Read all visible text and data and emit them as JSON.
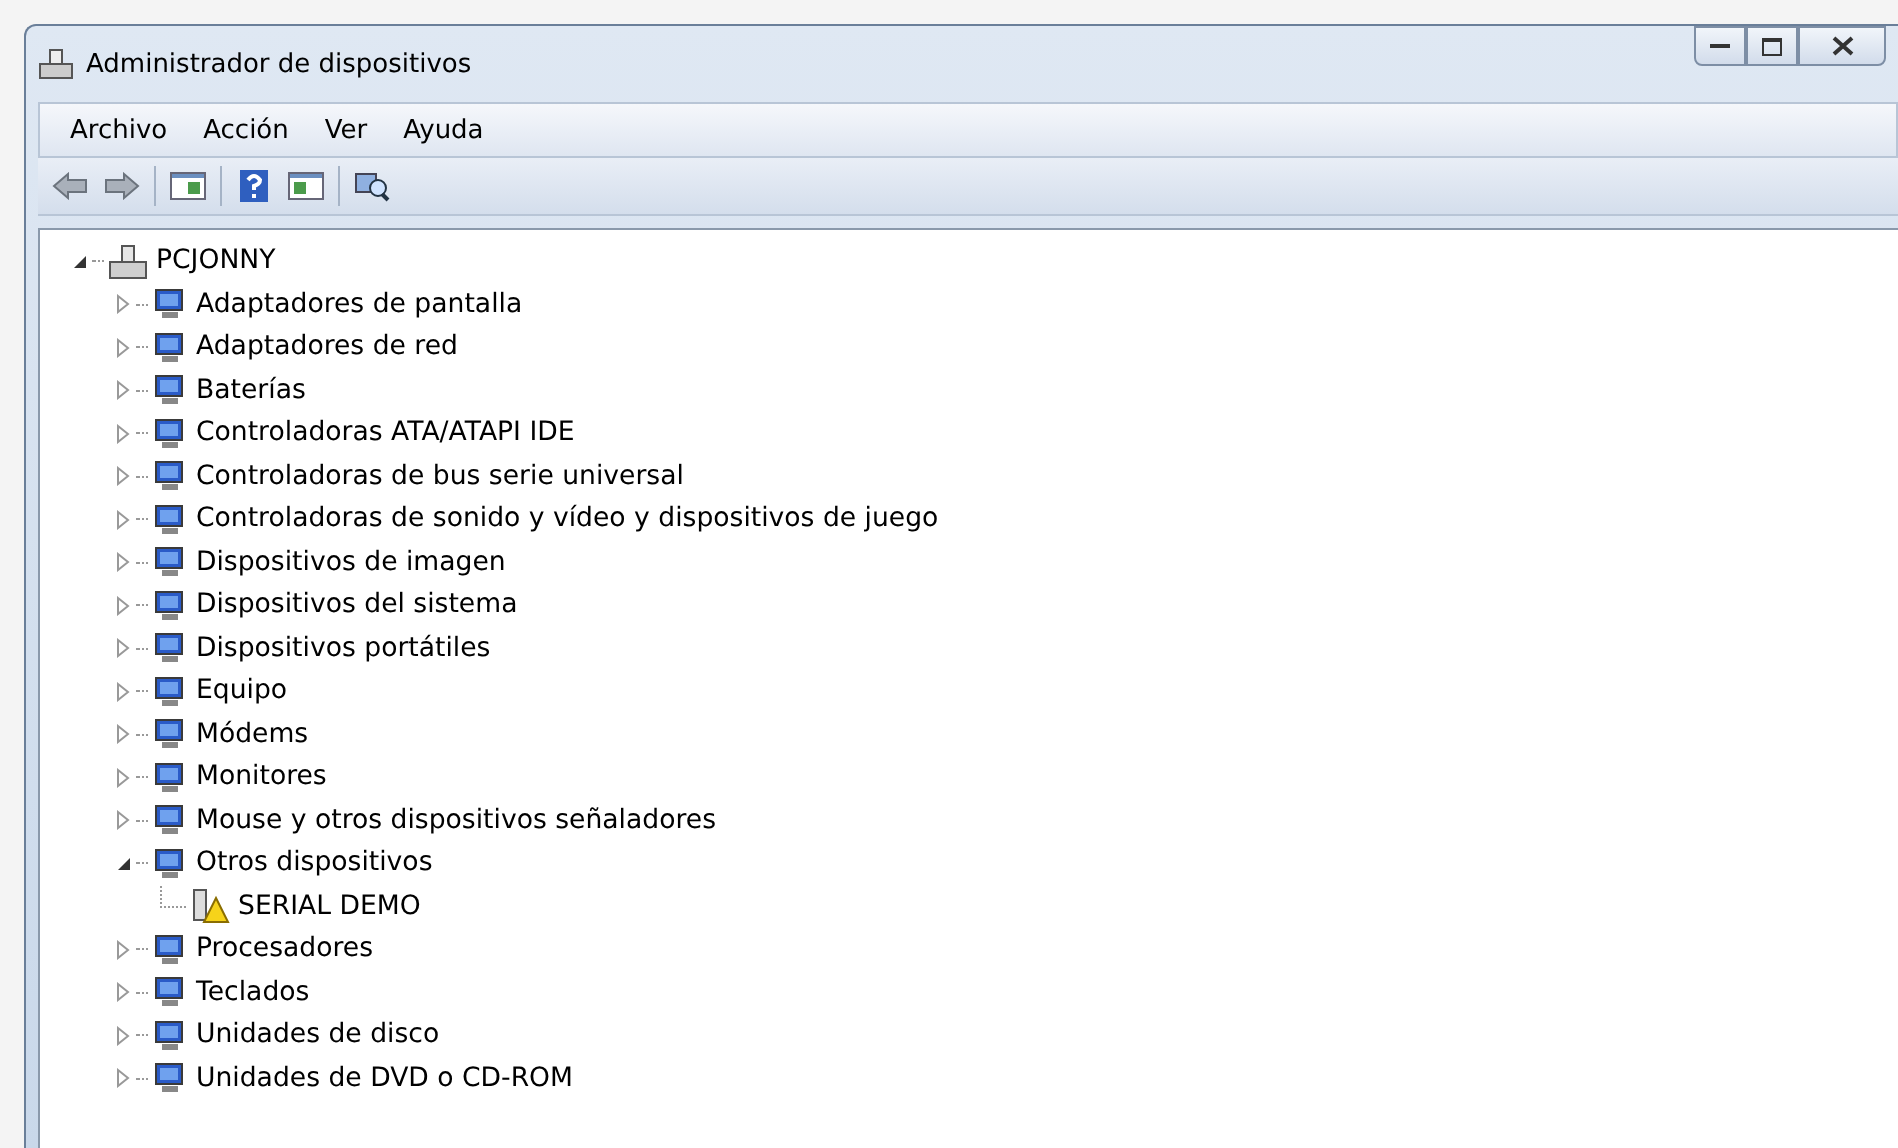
{
  "window": {
    "title": "Administrador de dispositivos"
  },
  "menu": [
    "Archivo",
    "Acción",
    "Ver",
    "Ayuda"
  ],
  "tree": {
    "label": "PCJONNY",
    "expanded": true,
    "children": [
      {
        "label": "Adaptadores de pantalla",
        "expanded": false
      },
      {
        "label": "Adaptadores de red",
        "expanded": false
      },
      {
        "label": "Baterías",
        "expanded": false
      },
      {
        "label": "Controladoras ATA/ATAPI IDE",
        "expanded": false
      },
      {
        "label": "Controladoras de bus serie universal",
        "expanded": false
      },
      {
        "label": "Controladoras de sonido y vídeo y dispositivos de juego",
        "expanded": false
      },
      {
        "label": "Dispositivos de imagen",
        "expanded": false
      },
      {
        "label": "Dispositivos del sistema",
        "expanded": false
      },
      {
        "label": "Dispositivos portátiles",
        "expanded": false
      },
      {
        "label": "Equipo",
        "expanded": false
      },
      {
        "label": "Módems",
        "expanded": false
      },
      {
        "label": "Monitores",
        "expanded": false
      },
      {
        "label": "Mouse y otros dispositivos señaladores",
        "expanded": false
      },
      {
        "label": "Otros dispositivos",
        "expanded": true,
        "children": [
          {
            "label": "SERIAL DEMO",
            "warning": true
          }
        ]
      },
      {
        "label": "Procesadores",
        "expanded": false
      },
      {
        "label": "Teclados",
        "expanded": false
      },
      {
        "label": "Unidades de disco",
        "expanded": false
      },
      {
        "label": "Unidades de DVD o CD-ROM",
        "expanded": false
      }
    ]
  }
}
